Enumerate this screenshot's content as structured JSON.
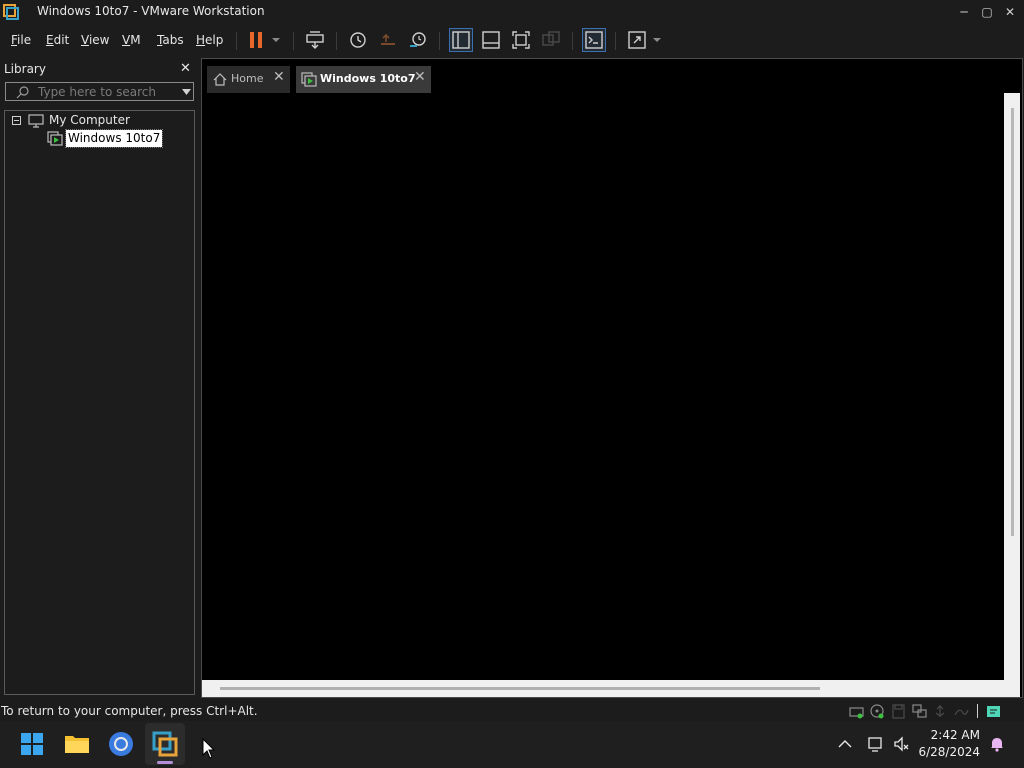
{
  "window": {
    "title": "Windows 10to7 - VMware Workstation",
    "controls": {
      "minimize": "─",
      "maximize": "▢",
      "close": "✕"
    }
  },
  "menu": {
    "items": [
      {
        "label": "File",
        "underline": "F",
        "rest": "ile"
      },
      {
        "label": "Edit",
        "underline": "E",
        "rest": "dit"
      },
      {
        "label": "View",
        "underline": "V",
        "rest": "iew"
      },
      {
        "label": "VM",
        "underline": "V",
        "rest": "M"
      },
      {
        "label": "Tabs",
        "underline": "T",
        "rest": "abs"
      },
      {
        "label": "Help",
        "underline": "H",
        "rest": "elp"
      }
    ]
  },
  "toolbar": {
    "icons": [
      "pause-icon",
      "send-ctrl-alt-del-icon",
      "snapshot-take-icon",
      "snapshot-revert-icon",
      "snapshot-manager-icon",
      "show-library-icon",
      "thumbnail-bar-icon",
      "full-screen-icon",
      "unity-icon",
      "console-view-icon",
      "stretch-guest-icon"
    ],
    "accent_pause": "#e8682c"
  },
  "library": {
    "title": "Library",
    "close": "✕",
    "search_placeholder": "Type here to search",
    "tree": {
      "root": "My Computer",
      "children": [
        "Windows 10to7"
      ]
    }
  },
  "tabs": [
    {
      "label": "Home",
      "close": "✕",
      "active": false
    },
    {
      "label": "Windows 10to7",
      "close": "✕",
      "active": true
    }
  ],
  "status": {
    "message": "To return to your computer, press Ctrl+Alt."
  },
  "taskbar": {
    "apps": [
      "windows-start-icon",
      "file-explorer-icon",
      "chrome-icon",
      "vmware-icon"
    ],
    "tray": {
      "chevron": "^",
      "time": "2:42 AM",
      "date": "6/28/2024"
    }
  },
  "colors": {
    "background": "#1c1c1c",
    "accent_blue": "#3a6fb0",
    "vmware_teal": "#36a0c8"
  }
}
